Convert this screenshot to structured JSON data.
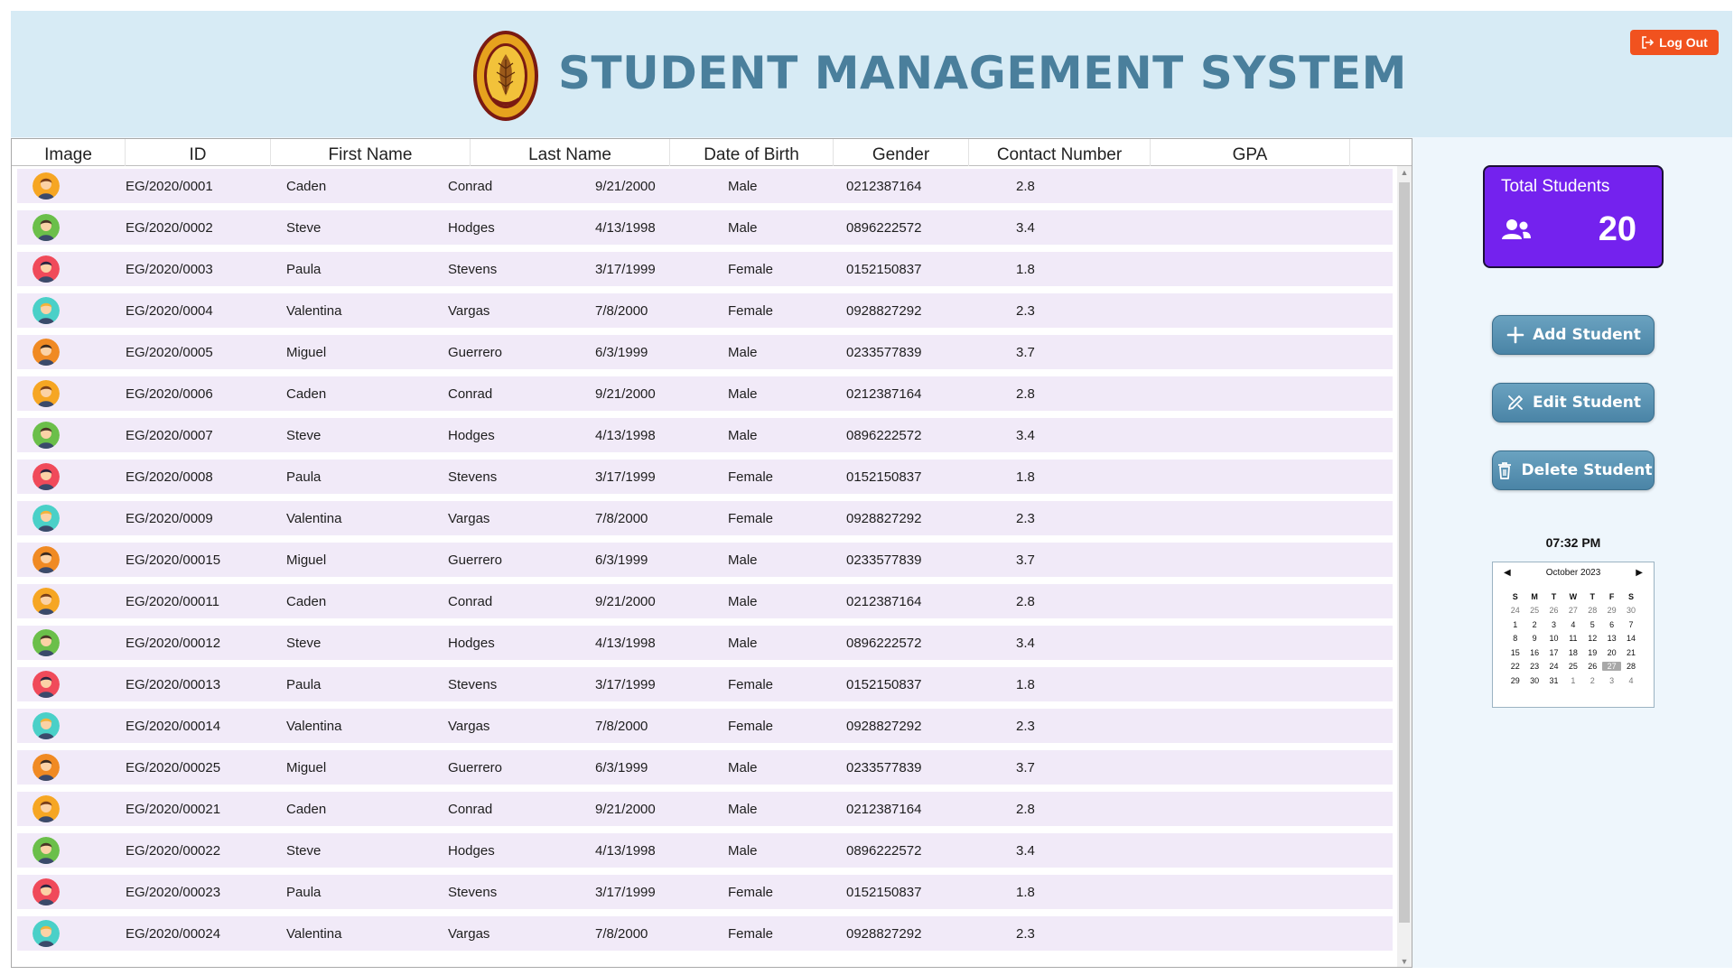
{
  "header": {
    "title": "STUDENT MANAGEMENT SYSTEM",
    "logout_label": "Log Out"
  },
  "table": {
    "columns": [
      "Image",
      "ID",
      "First Name",
      "Last Name",
      "Date of Birth",
      "Gender",
      "Contact Number",
      "GPA"
    ],
    "rows": [
      {
        "avatar": "male-avatar-yellow",
        "id": "EG/2020/0001",
        "first": "Caden",
        "last": "Conrad",
        "dob": "9/21/2000",
        "gender": "Male",
        "contact": "0212387164",
        "gpa": "2.8"
      },
      {
        "avatar": "male-avatar-green",
        "id": "EG/2020/0002",
        "first": "Steve",
        "last": "Hodges",
        "dob": "4/13/1998",
        "gender": "Male",
        "contact": "0896222572",
        "gpa": "3.4"
      },
      {
        "avatar": "female-avatar-red",
        "id": "EG/2020/0003",
        "first": "Paula",
        "last": "Stevens",
        "dob": "3/17/1999",
        "gender": "Female",
        "contact": "0152150837",
        "gpa": "1.8"
      },
      {
        "avatar": "female-avatar-teal",
        "id": "EG/2020/0004",
        "first": "Valentina",
        "last": "Vargas",
        "dob": "7/8/2000",
        "gender": "Female",
        "contact": "0928827292",
        "gpa": "2.3"
      },
      {
        "avatar": "male-avatar-orange",
        "id": "EG/2020/0005",
        "first": "Miguel",
        "last": "Guerrero",
        "dob": "6/3/1999",
        "gender": "Male",
        "contact": "0233577839",
        "gpa": "3.7"
      },
      {
        "avatar": "male-avatar-yellow",
        "id": "EG/2020/0006",
        "first": "Caden",
        "last": "Conrad",
        "dob": "9/21/2000",
        "gender": "Male",
        "contact": "0212387164",
        "gpa": "2.8"
      },
      {
        "avatar": "male-avatar-green",
        "id": "EG/2020/0007",
        "first": "Steve",
        "last": "Hodges",
        "dob": "4/13/1998",
        "gender": "Male",
        "contact": "0896222572",
        "gpa": "3.4"
      },
      {
        "avatar": "female-avatar-red",
        "id": "EG/2020/0008",
        "first": "Paula",
        "last": "Stevens",
        "dob": "3/17/1999",
        "gender": "Female",
        "contact": "0152150837",
        "gpa": "1.8"
      },
      {
        "avatar": "female-avatar-teal",
        "id": "EG/2020/0009",
        "first": "Valentina",
        "last": "Vargas",
        "dob": "7/8/2000",
        "gender": "Female",
        "contact": "0928827292",
        "gpa": "2.3"
      },
      {
        "avatar": "male-avatar-orange",
        "id": "EG/2020/00015",
        "first": "Miguel",
        "last": "Guerrero",
        "dob": "6/3/1999",
        "gender": "Male",
        "contact": "0233577839",
        "gpa": "3.7"
      },
      {
        "avatar": "male-avatar-yellow",
        "id": "EG/2020/00011",
        "first": "Caden",
        "last": "Conrad",
        "dob": "9/21/2000",
        "gender": "Male",
        "contact": "0212387164",
        "gpa": "2.8"
      },
      {
        "avatar": "male-avatar-green",
        "id": "EG/2020/00012",
        "first": "Steve",
        "last": "Hodges",
        "dob": "4/13/1998",
        "gender": "Male",
        "contact": "0896222572",
        "gpa": "3.4"
      },
      {
        "avatar": "female-avatar-red",
        "id": "EG/2020/00013",
        "first": "Paula",
        "last": "Stevens",
        "dob": "3/17/1999",
        "gender": "Female",
        "contact": "0152150837",
        "gpa": "1.8"
      },
      {
        "avatar": "female-avatar-teal",
        "id": "EG/2020/00014",
        "first": "Valentina",
        "last": "Vargas",
        "dob": "7/8/2000",
        "gender": "Female",
        "contact": "0928827292",
        "gpa": "2.3"
      },
      {
        "avatar": "male-avatar-orange",
        "id": "EG/2020/00025",
        "first": "Miguel",
        "last": "Guerrero",
        "dob": "6/3/1999",
        "gender": "Male",
        "contact": "0233577839",
        "gpa": "3.7"
      },
      {
        "avatar": "male-avatar-yellow",
        "id": "EG/2020/00021",
        "first": "Caden",
        "last": "Conrad",
        "dob": "9/21/2000",
        "gender": "Male",
        "contact": "0212387164",
        "gpa": "2.8"
      },
      {
        "avatar": "male-avatar-green",
        "id": "EG/2020/00022",
        "first": "Steve",
        "last": "Hodges",
        "dob": "4/13/1998",
        "gender": "Male",
        "contact": "0896222572",
        "gpa": "3.4"
      },
      {
        "avatar": "female-avatar-red",
        "id": "EG/2020/00023",
        "first": "Paula",
        "last": "Stevens",
        "dob": "3/17/1999",
        "gender": "Female",
        "contact": "0152150837",
        "gpa": "1.8"
      },
      {
        "avatar": "female-avatar-teal",
        "id": "EG/2020/00024",
        "first": "Valentina",
        "last": "Vargas",
        "dob": "7/8/2000",
        "gender": "Female",
        "contact": "0928827292",
        "gpa": "2.3"
      }
    ]
  },
  "stats": {
    "label": "Total Students",
    "value": "20",
    "icon": "users-icon"
  },
  "actions": {
    "add_label": "Add Student",
    "edit_label": "Edit Student",
    "delete_label": "Delete Student"
  },
  "clock": {
    "time": "07:32 PM"
  },
  "calendar": {
    "month_label": "October 2023",
    "weekdays": [
      "S",
      "M",
      "T",
      "W",
      "T",
      "F",
      "S"
    ],
    "weeks": [
      [
        "24",
        "25",
        "26",
        "27",
        "28",
        "29",
        "30"
      ],
      [
        "1",
        "2",
        "3",
        "4",
        "5",
        "6",
        "7"
      ],
      [
        "8",
        "9",
        "10",
        "11",
        "12",
        "13",
        "14"
      ],
      [
        "15",
        "16",
        "17",
        "18",
        "19",
        "20",
        "21"
      ],
      [
        "22",
        "23",
        "24",
        "25",
        "26",
        "27",
        "28"
      ],
      [
        "29",
        "30",
        "31",
        "1",
        "2",
        "3",
        "4"
      ]
    ],
    "today": "27"
  },
  "colors": {
    "header_bg": "#d7ebf5",
    "title": "#4a7f9c",
    "logout": "#f1521f",
    "stat_card": "#7422ee",
    "row_bg": "#f1eaf8",
    "button": "#4a84a6"
  }
}
